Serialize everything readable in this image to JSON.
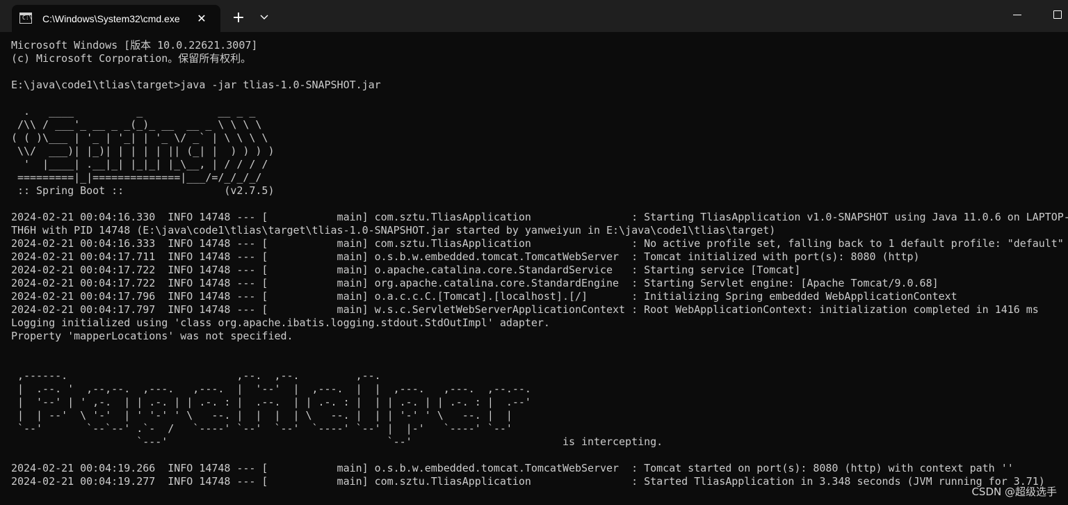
{
  "tab": {
    "title": "C:\\Windows\\System32\\cmd.exe",
    "close_glyph": "✕",
    "new_tab_glyph": "+",
    "icon_glyph": "C:\\"
  },
  "icons": {
    "tab": "cmd-icon",
    "close": "close-icon",
    "new_tab": "plus-icon",
    "dropdown": "chevron-down-icon",
    "minimize": "minimize-icon",
    "maximize": "maximize-icon"
  },
  "colors": {
    "background": "#0c0c0c",
    "titlebar": "#1f1f1f",
    "text": "#cccccc"
  },
  "terminal": {
    "output": "Microsoft Windows [版本 10.0.22621.3007]\n(c) Microsoft Corporation。保留所有权利。\n\nE:\\java\\code1\\tlias\\target>java -jar tlias-1.0-SNAPSHOT.jar\n\n  .   ____          _            __ _ _\n /\\\\ / ___'_ __ _ _(_)_ __  __ _ \\ \\ \\ \\\n( ( )\\___ | '_ | '_| | '_ \\/ _` | \\ \\ \\ \\\n \\\\/  ___)| |_)| | | | | || (_| |  ) ) ) )\n  '  |____| .__|_| |_|_| |_\\__, | / / / /\n =========|_|==============|___/=/_/_/_/\n :: Spring Boot ::                (v2.7.5)\n\n2024-02-21 00:04:16.330  INFO 14748 --- [           main] com.sztu.TliasApplication                : Starting TliasApplication v1.0-SNAPSHOT using Java 11.0.6 on LAPTOP-\nTH6H with PID 14748 (E:\\java\\code1\\tlias\\target\\tlias-1.0-SNAPSHOT.jar started by yanweiyun in E:\\java\\code1\\tlias\\target)\n2024-02-21 00:04:16.333  INFO 14748 --- [           main] com.sztu.TliasApplication                : No active profile set, falling back to 1 default profile: \"default\"\n2024-02-21 00:04:17.711  INFO 14748 --- [           main] o.s.b.w.embedded.tomcat.TomcatWebServer  : Tomcat initialized with port(s): 8080 (http)\n2024-02-21 00:04:17.722  INFO 14748 --- [           main] o.apache.catalina.core.StandardService   : Starting service [Tomcat]\n2024-02-21 00:04:17.722  INFO 14748 --- [           main] org.apache.catalina.core.StandardEngine  : Starting Servlet engine: [Apache Tomcat/9.0.68]\n2024-02-21 00:04:17.796  INFO 14748 --- [           main] o.a.c.c.C.[Tomcat].[localhost].[/]       : Initializing Spring embedded WebApplicationContext\n2024-02-21 00:04:17.797  INFO 14748 --- [           main] w.s.c.ServletWebServerApplicationContext : Root WebApplicationContext: initialization completed in 1416 ms\nLogging initialized using 'class org.apache.ibatis.logging.stdout.StdOutImpl' adapter.\nProperty 'mapperLocations' was not specified.\n\n\n ,------.                           ,--.  ,--.         ,--.\n |  .--. '  ,--,--.  ,---.   ,---.  |  '--'  |  ,---.  |  |  ,---.   ,---.  ,--.--.\n |  '--' | ' ,-.  | | .-. | | .-. : |  .--.  | | .-. : |  | | .-. | | .-. : |  .--'\n |  | --'  \\ '-'  | ' '-' ' \\   --. |  |  |  | \\   --. |  | | '-' ' \\   --. |  |\n `--'       `--`--' .`-  /   `----' `--'  `--'  `----' `--' |  |-'   `----' `--'\n                    `---'                                   `--'                        is intercepting.\n\n2024-02-21 00:04:19.266  INFO 14748 --- [           main] o.s.b.w.embedded.tomcat.TomcatWebServer  : Tomcat started on port(s): 8080 (http) with context path ''\n2024-02-21 00:04:19.277  INFO 14748 --- [           main] com.sztu.TliasApplication                : Started TliasApplication in 3.348 seconds (JVM running for 3.71)"
  },
  "watermark": {
    "text": "CSDN @超级选手"
  }
}
